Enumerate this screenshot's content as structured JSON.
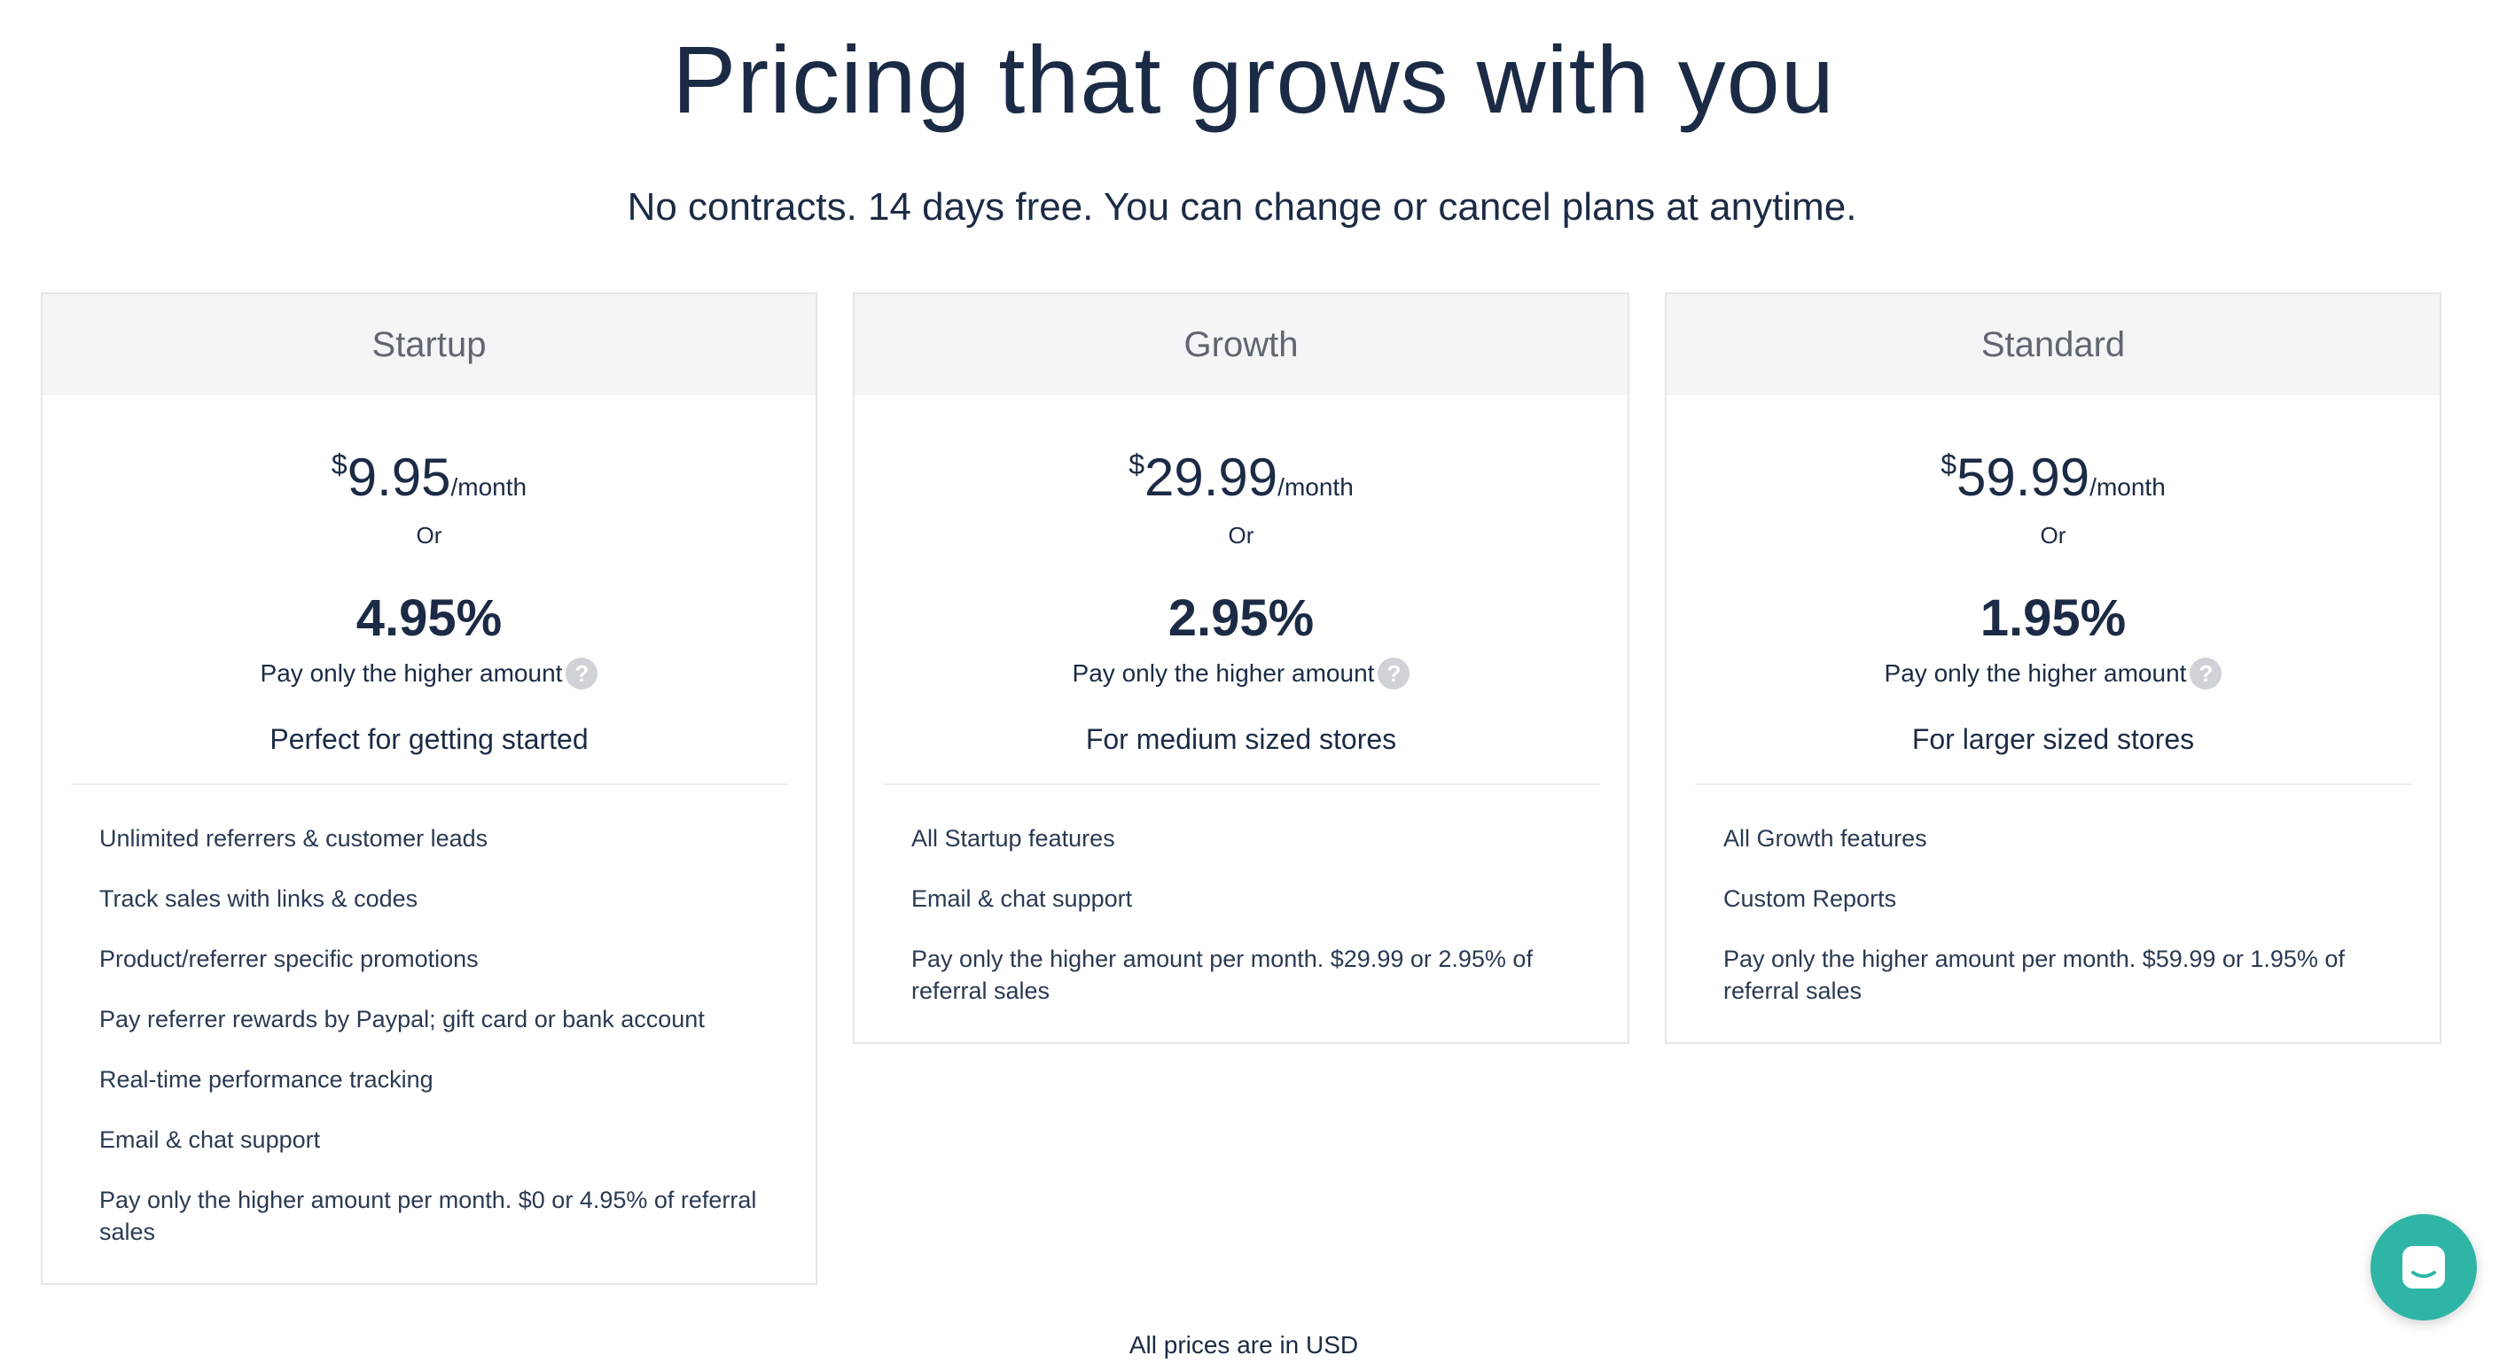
{
  "hero": {
    "title": "Pricing that grows with you",
    "subtitle": "No contracts. 14 days free. You can change or cancel plans at anytime."
  },
  "plans": [
    {
      "name": "Startup",
      "currency": "$",
      "amount": "9.95",
      "period": "/month",
      "or_label": "Or",
      "percent": "4.95%",
      "higher_label": "Pay only the higher amount",
      "tagline": "Perfect for getting started",
      "features": [
        "Unlimited referrers & customer leads",
        "Track sales with links & codes",
        "Product/referrer specific promotions",
        "Pay referrer rewards by Paypal; gift card or bank account",
        "Real-time performance tracking",
        "Email & chat support",
        "Pay only the higher amount per month. $0 or 4.95% of referral sales"
      ]
    },
    {
      "name": "Growth",
      "currency": "$",
      "amount": "29.99",
      "period": "/month",
      "or_label": "Or",
      "percent": "2.95%",
      "higher_label": "Pay only the higher amount",
      "tagline": "For medium sized stores",
      "features": [
        "All Startup features",
        "Email & chat support",
        "Pay only the higher amount per month. $29.99 or 2.95% of referral sales"
      ]
    },
    {
      "name": "Standard",
      "currency": "$",
      "amount": "59.99",
      "period": "/month",
      "or_label": "Or",
      "percent": "1.95%",
      "higher_label": "Pay only the higher amount",
      "tagline": "For larger sized stores",
      "features": [
        "All Growth features",
        "Custom Reports",
        "Pay only the higher amount per month. $59.99 or 1.95% of referral sales"
      ]
    }
  ],
  "help_glyph": "?",
  "footnote": "All prices are in USD",
  "chat": {
    "icon": "chat-icon",
    "color": "#2fb5a6"
  },
  "colors": {
    "heading": "#1c2b45",
    "card_header_bg": "#f4f5f7",
    "accent": "#2fb5a6"
  }
}
